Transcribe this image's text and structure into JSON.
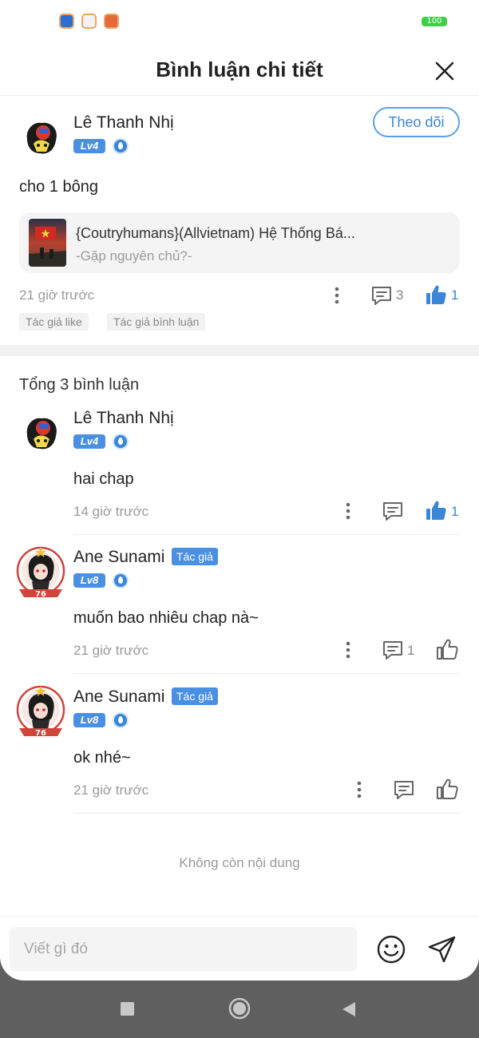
{
  "status_bar": {
    "battery": "100"
  },
  "header": {
    "title": "Bình luận chi tiết"
  },
  "main_comment": {
    "username": "Lê Thanh Nhị",
    "level": "Lv4",
    "follow_label": "Theo dõi",
    "text": "cho 1 bông",
    "story": {
      "title": "{Coutryhumans}(Allvietnam) Hệ Thống Bá...",
      "subtitle": "-Gặp nguyên chủ?-"
    },
    "time": "21 giờ trước",
    "reply_count": "3",
    "like_count": "1",
    "tags": [
      "Tác giả like",
      "Tác giả bình luận"
    ]
  },
  "total_label": "Tổng 3 bình luận",
  "replies": [
    {
      "username": "Lê Thanh Nhị",
      "level": "Lv4",
      "author_badge": "",
      "text": "hai chap",
      "time": "14 giờ trước",
      "reply_count": "",
      "like_count": "1",
      "liked": true
    },
    {
      "username": "Ane Sunami",
      "level": "Lv8",
      "author_badge": "Tác giả",
      "text": "muốn bao nhiêu chap nà~",
      "time": "21 giờ trước",
      "reply_count": "1",
      "like_count": "",
      "liked": false
    },
    {
      "username": "Ane Sunami",
      "level": "Lv8",
      "author_badge": "Tác giả",
      "text": "ok nhé~",
      "time": "21 giờ trước",
      "reply_count": "",
      "like_count": "",
      "liked": false
    }
  ],
  "end_text": "Không còn nội dung",
  "input": {
    "placeholder": "Viết gì đó"
  },
  "colors": {
    "accent": "#4a90e2",
    "like_blue": "#3b86d6",
    "battery_green": "#3ecf4a"
  },
  "icons": [
    "close-icon",
    "more-vertical-icon",
    "comment-icon",
    "thumbs-up-icon",
    "emoji-icon",
    "send-icon",
    "nav-square-icon",
    "nav-circle-icon",
    "nav-back-icon"
  ]
}
